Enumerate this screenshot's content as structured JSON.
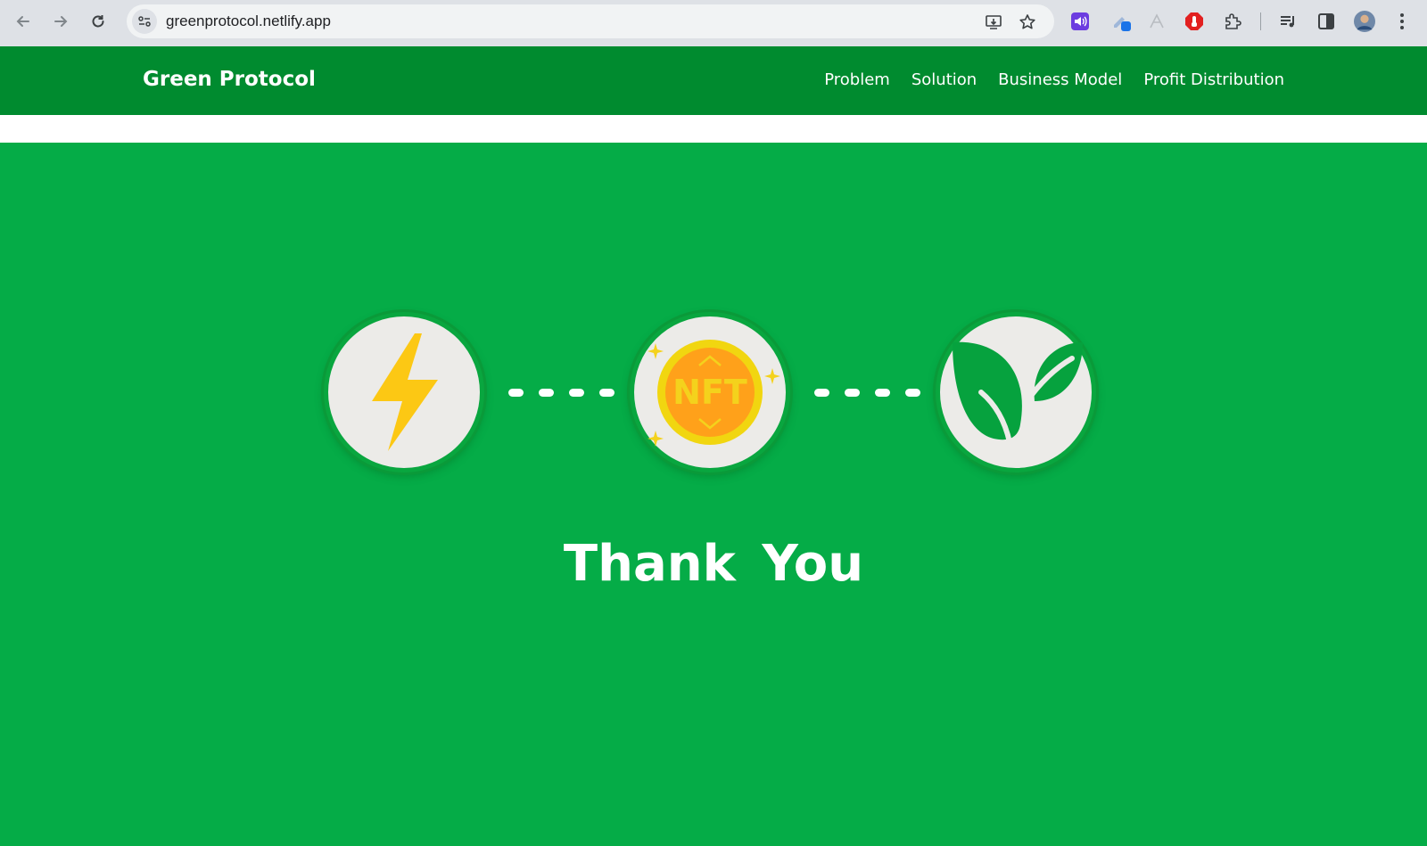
{
  "browser": {
    "url": "greenprotocol.netlify.app"
  },
  "site": {
    "brand": "Green Protocol",
    "nav": [
      "Problem",
      "Solution",
      "Business Model",
      "Profit Distribution"
    ]
  },
  "hero": {
    "icons": [
      "lightning-icon",
      "nft-coin-icon",
      "leaf-icon"
    ],
    "nft_label": "NFT",
    "thank_you": "Thank You"
  },
  "colors": {
    "header_green": "#008b2f",
    "hero_green": "#05ac47",
    "circle_bg": "#ecebe8",
    "bolt_yellow": "#fcc814",
    "coin_orange": "#ffa11a"
  }
}
